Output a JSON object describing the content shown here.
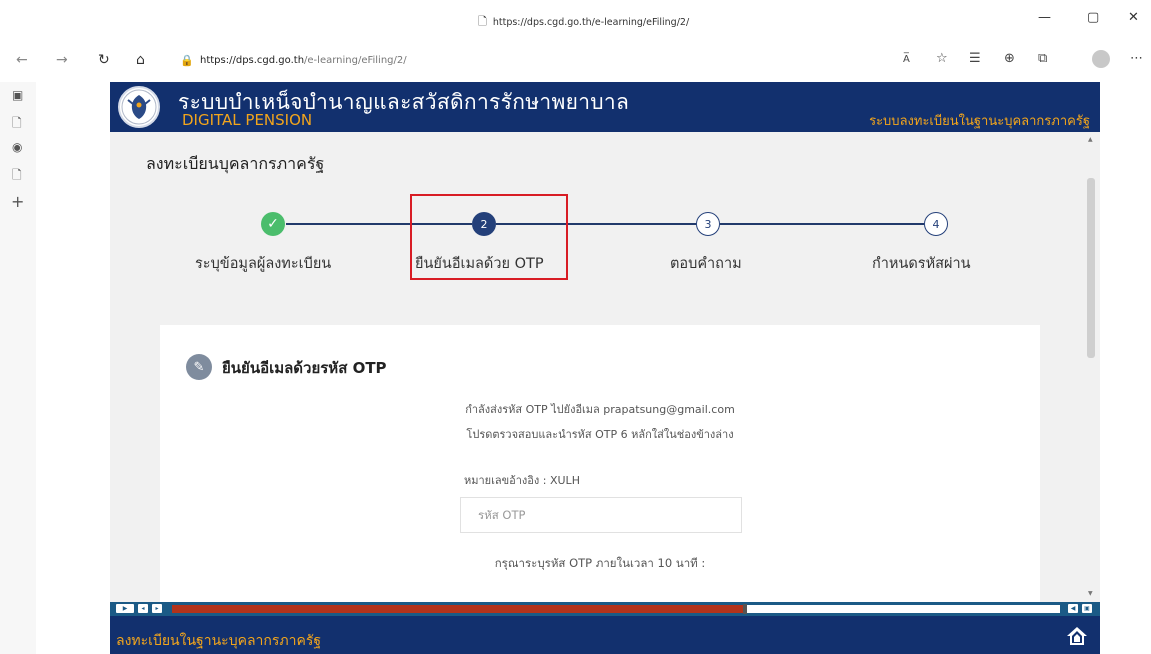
{
  "browser": {
    "title_url": "https://dps.cgd.go.th/e-learning/eFiling/2/",
    "address": {
      "domain": "https://dps.cgd.go.th",
      "path": "/e-learning/eFiling/2/"
    },
    "read_aloud": "A̅"
  },
  "site": {
    "title_th": "ระบบบำเหน็จบำนาญและสวัสดิการรักษาพยาบาล",
    "title_en": "DIGITAL PENSION",
    "header_right": "ระบบลงทะเบียนในฐานะบุคลากรภาครัฐ",
    "footer_text": "ลงทะเบียนในฐานะบุคลากรภาครัฐ"
  },
  "page": {
    "title": "ลงทะเบียนบุคลากรภาครัฐ"
  },
  "steps": [
    {
      "number": "✓",
      "label": "ระบุข้อมูลผู้ลงทะเบียน",
      "state": "done"
    },
    {
      "number": "2",
      "label": "ยืนยันอีเมลด้วย OTP",
      "state": "active"
    },
    {
      "number": "3",
      "label": "ตอบคำถาม",
      "state": "pending"
    },
    {
      "number": "4",
      "label": "กำหนดรหัสผ่าน",
      "state": "pending"
    }
  ],
  "otp_card": {
    "title": "ยืนยันอีเมลด้วยรหัส OTP",
    "sent_message": "กำลังส่งรหัส OTP ไปยังอีเมล prapatsung@gmail.com",
    "instruction": "โปรดตรวจสอบและนำรหัส OTP 6 หลักใส่ในช่องข้างล่าง",
    "reference": "หมายเลขอ้างอิง : XULH",
    "input_placeholder": "รหัส OTP",
    "deadline": "กรุณาระบุรหัส OTP ภายในเวลา 10 นาที :"
  },
  "player": {
    "progress": 0.645
  },
  "colors": {
    "header_bg": "#12306e",
    "accent_orange": "#f2a51c",
    "step_done": "#4bbd6c",
    "step_active": "#24407a",
    "highlight_red": "#d81c24",
    "progress_fill": "#b3331b"
  }
}
